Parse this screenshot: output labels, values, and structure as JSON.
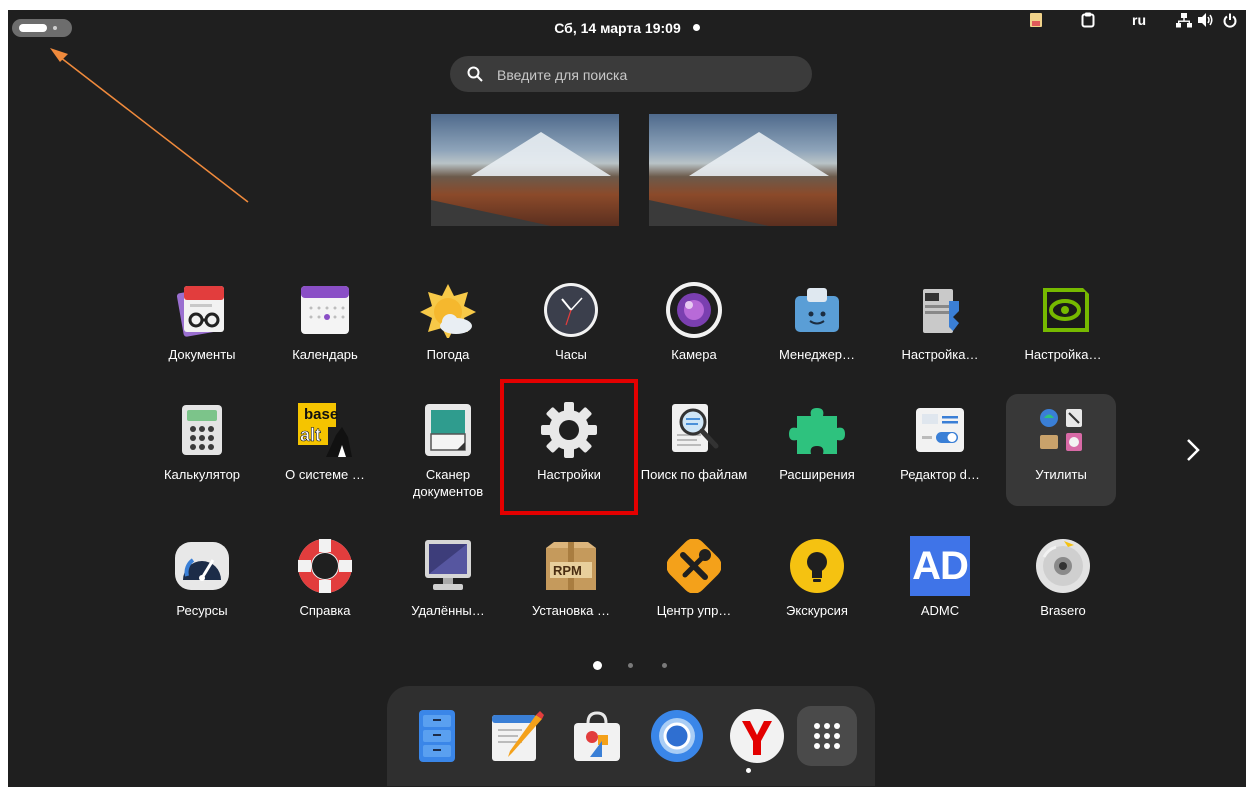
{
  "topbar": {
    "datetime": "Сб, 14 марта 19:09",
    "lang": "ru",
    "tray_icons": [
      "clipboard-notes-icon",
      "clipboard-icon",
      "network-icon",
      "volume-icon",
      "power-icon"
    ]
  },
  "search": {
    "placeholder": "Введите для поиска"
  },
  "workspaces": [
    {
      "name": "workspace-1",
      "thumbnail": "mountain-landscape"
    },
    {
      "name": "workspace-2",
      "thumbnail": "mountain-landscape"
    }
  ],
  "apps": {
    "row1": [
      {
        "label": "Документы",
        "icon": "documents-icon"
      },
      {
        "label": "Календарь",
        "icon": "calendar-icon"
      },
      {
        "label": "Погода",
        "icon": "weather-icon"
      },
      {
        "label": "Часы",
        "icon": "clock-icon"
      },
      {
        "label": "Камера",
        "icon": "camera-icon"
      },
      {
        "label": "Менеджер…",
        "icon": "manager-icon"
      },
      {
        "label": "Настройка…",
        "icon": "printer-settings-icon"
      },
      {
        "label": "Настройка…",
        "icon": "nvidia-settings-icon"
      }
    ],
    "row2": [
      {
        "label": "Калькулятор",
        "icon": "calculator-icon"
      },
      {
        "label": "О системе …",
        "icon": "basealt-icon"
      },
      {
        "label": "Сканер документов",
        "icon": "scanner-icon"
      },
      {
        "label": "Настройки",
        "icon": "settings-gear-icon"
      },
      {
        "label": "Поиск по файлам",
        "icon": "file-search-icon"
      },
      {
        "label": "Расширения",
        "icon": "extensions-puzzle-icon"
      },
      {
        "label": "Редактор d…",
        "icon": "dconf-editor-icon"
      },
      {
        "label": "Утилиты",
        "icon": "utilities-folder-icon"
      }
    ],
    "row3": [
      {
        "label": "Ресурсы",
        "icon": "resources-gauge-icon"
      },
      {
        "label": "Справка",
        "icon": "help-lifebuoy-icon"
      },
      {
        "label": "Удалённы…",
        "icon": "remote-desktop-icon"
      },
      {
        "label": "Установка …",
        "icon": "rpm-package-icon"
      },
      {
        "label": "Центр упр…",
        "icon": "control-center-icon"
      },
      {
        "label": "Экскурсия",
        "icon": "tour-lightbulb-icon"
      },
      {
        "label": "ADMC",
        "icon": "admc-icon"
      },
      {
        "label": "Brasero",
        "icon": "brasero-disc-icon"
      }
    ]
  },
  "admc_icon_text": "AD",
  "rpm_icon_text": "RPM",
  "basealt_icon_text": [
    "base",
    "alt"
  ],
  "pagination": {
    "pages": 3,
    "current": 1
  },
  "dock": [
    {
      "name": "files",
      "icon": "files-cabinet-icon"
    },
    {
      "name": "text-editor",
      "icon": "text-editor-icon"
    },
    {
      "name": "software-store",
      "icon": "store-bag-icon"
    },
    {
      "name": "chromium",
      "icon": "chromium-icon"
    },
    {
      "name": "yandex-browser",
      "icon": "yandex-icon"
    },
    {
      "name": "show-apps",
      "icon": "app-grid-icon"
    }
  ],
  "colors": {
    "background": "#1f1f1f",
    "highlight_box": "#e30000",
    "annotation_arrow": "#f08a3c"
  }
}
